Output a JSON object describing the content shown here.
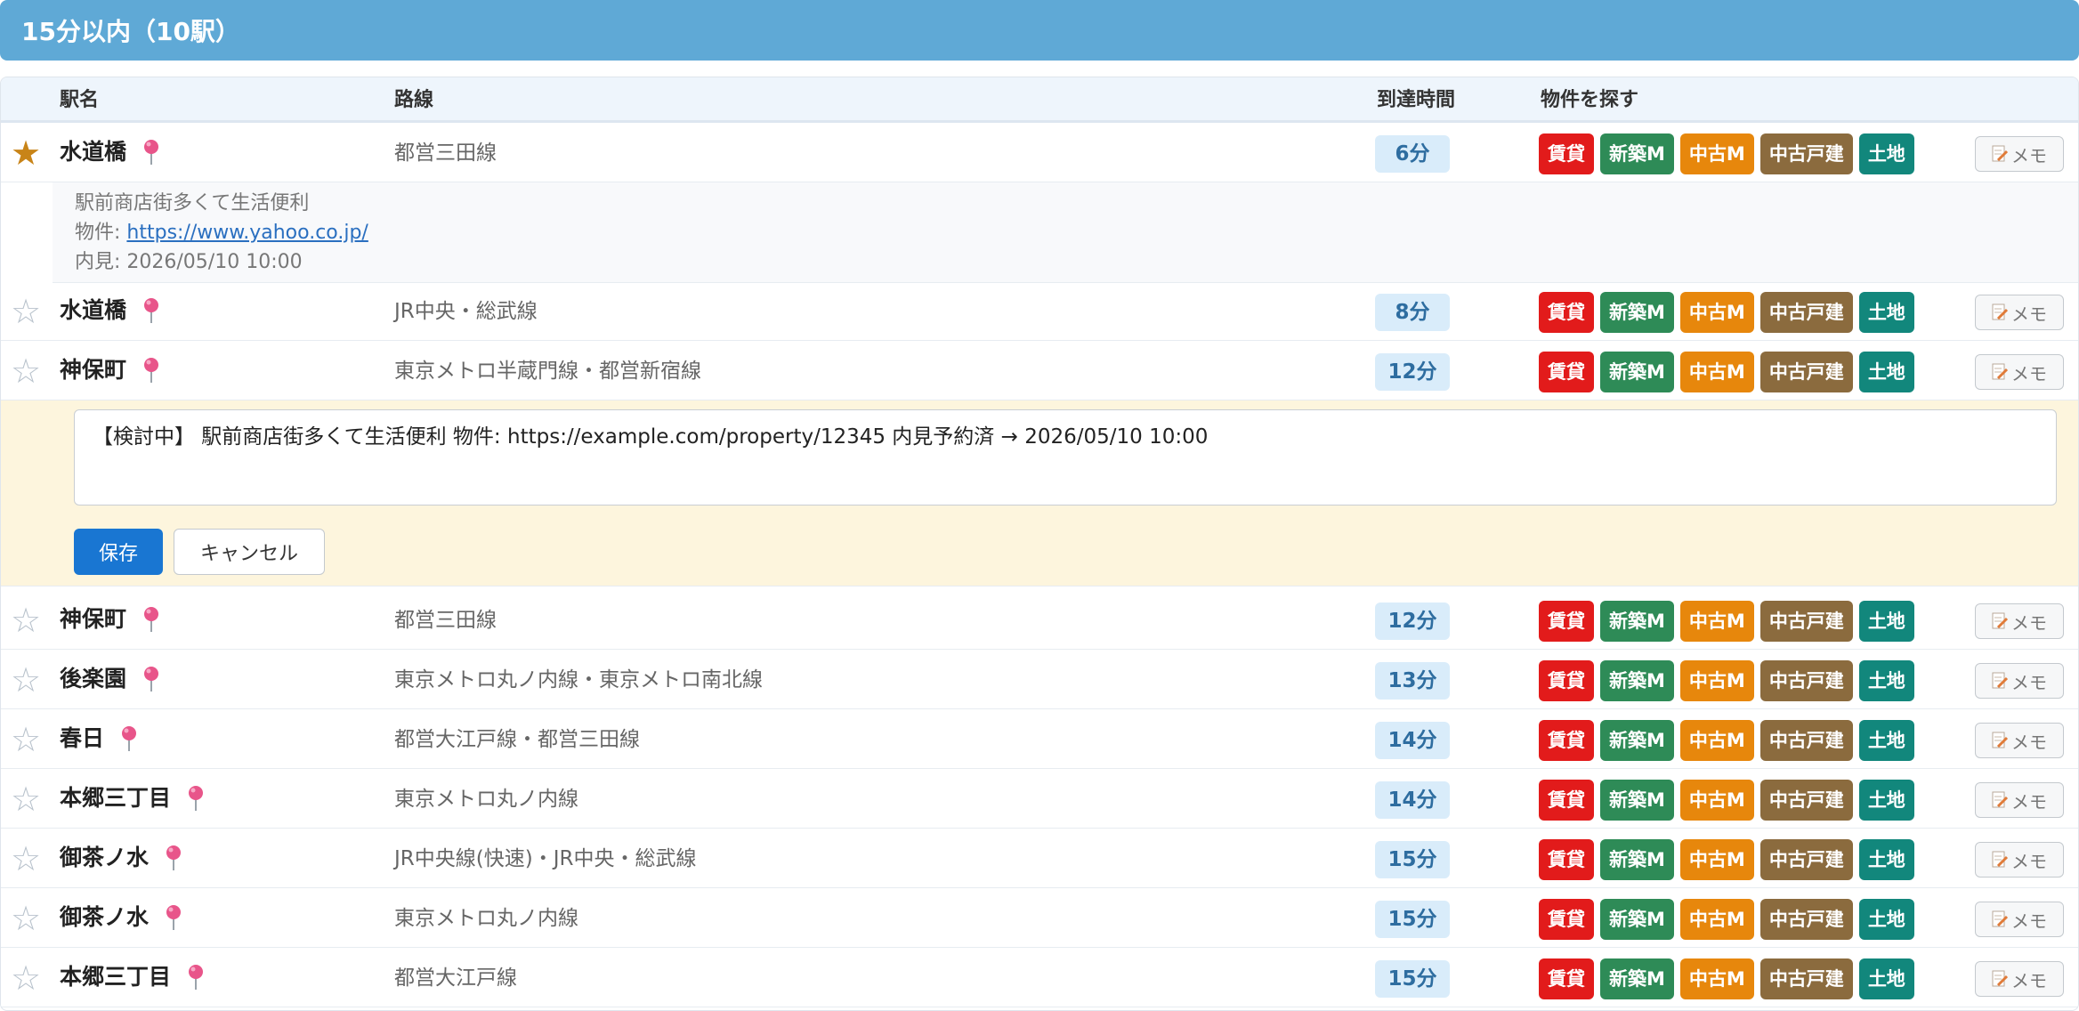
{
  "header": {
    "title": "15分以内（10駅）"
  },
  "columns": {
    "station": "駅名",
    "line": "路線",
    "time": "到達時間",
    "search": "物件を探す"
  },
  "tags": {
    "rent": "賃貸",
    "new_mansion": "新築M",
    "used_mansion": "中古M",
    "used_house": "中古戸建",
    "land": "土地"
  },
  "memo_button_label": "メモ",
  "rows": [
    {
      "starred": true,
      "station": "水道橋",
      "line": "都営三田線",
      "time": "6分"
    },
    {
      "starred": false,
      "station": "水道橋",
      "line": "JR中央・総武線",
      "time": "8分"
    },
    {
      "starred": false,
      "station": "神保町",
      "line": "東京メトロ半蔵門線・都営新宿線",
      "time": "12分"
    },
    {
      "starred": false,
      "station": "神保町",
      "line": "都営三田線",
      "time": "12分"
    },
    {
      "starred": false,
      "station": "後楽園",
      "line": "東京メトロ丸ノ内線・東京メトロ南北線",
      "time": "13分"
    },
    {
      "starred": false,
      "station": "春日",
      "line": "都営大江戸線・都営三田線",
      "time": "14分"
    },
    {
      "starred": false,
      "station": "本郷三丁目",
      "line": "東京メトロ丸ノ内線",
      "time": "14分"
    },
    {
      "starred": false,
      "station": "御茶ノ水",
      "line": "JR中央線(快速)・JR中央・総武線",
      "time": "15分"
    },
    {
      "starred": false,
      "station": "御茶ノ水",
      "line": "東京メトロ丸ノ内線",
      "time": "15分"
    },
    {
      "starred": false,
      "station": "本郷三丁目",
      "line": "都営大江戸線",
      "time": "15分"
    }
  ],
  "memo_note": {
    "line1": "駅前商店街多くて生活便利",
    "property_label": "物件: ",
    "property_url": "https://www.yahoo.co.jp/",
    "viewing": "内見: 2026/05/10 10:00"
  },
  "memo_editor": {
    "value": "【検討中】 駅前商店街多くて生活便利 物件: https://example.com/property/12345 内見予約済 → 2026/05/10 10:00",
    "save_label": "保存",
    "cancel_label": "キャンセル"
  },
  "colors": {
    "header_bg": "#5fa9d6",
    "star_on": "#c88418",
    "rent": "#e21b1b",
    "new_mansion": "#2e8b57",
    "used_mansion": "#e7870c",
    "used_house": "#8b6b3e",
    "land": "#12877c",
    "time_badge": "#d9ecfa",
    "editor_bg": "#fdf5dd"
  },
  "icons": {
    "star": "star-icon",
    "pin": "map-pin-icon",
    "memo": "memo-icon"
  }
}
